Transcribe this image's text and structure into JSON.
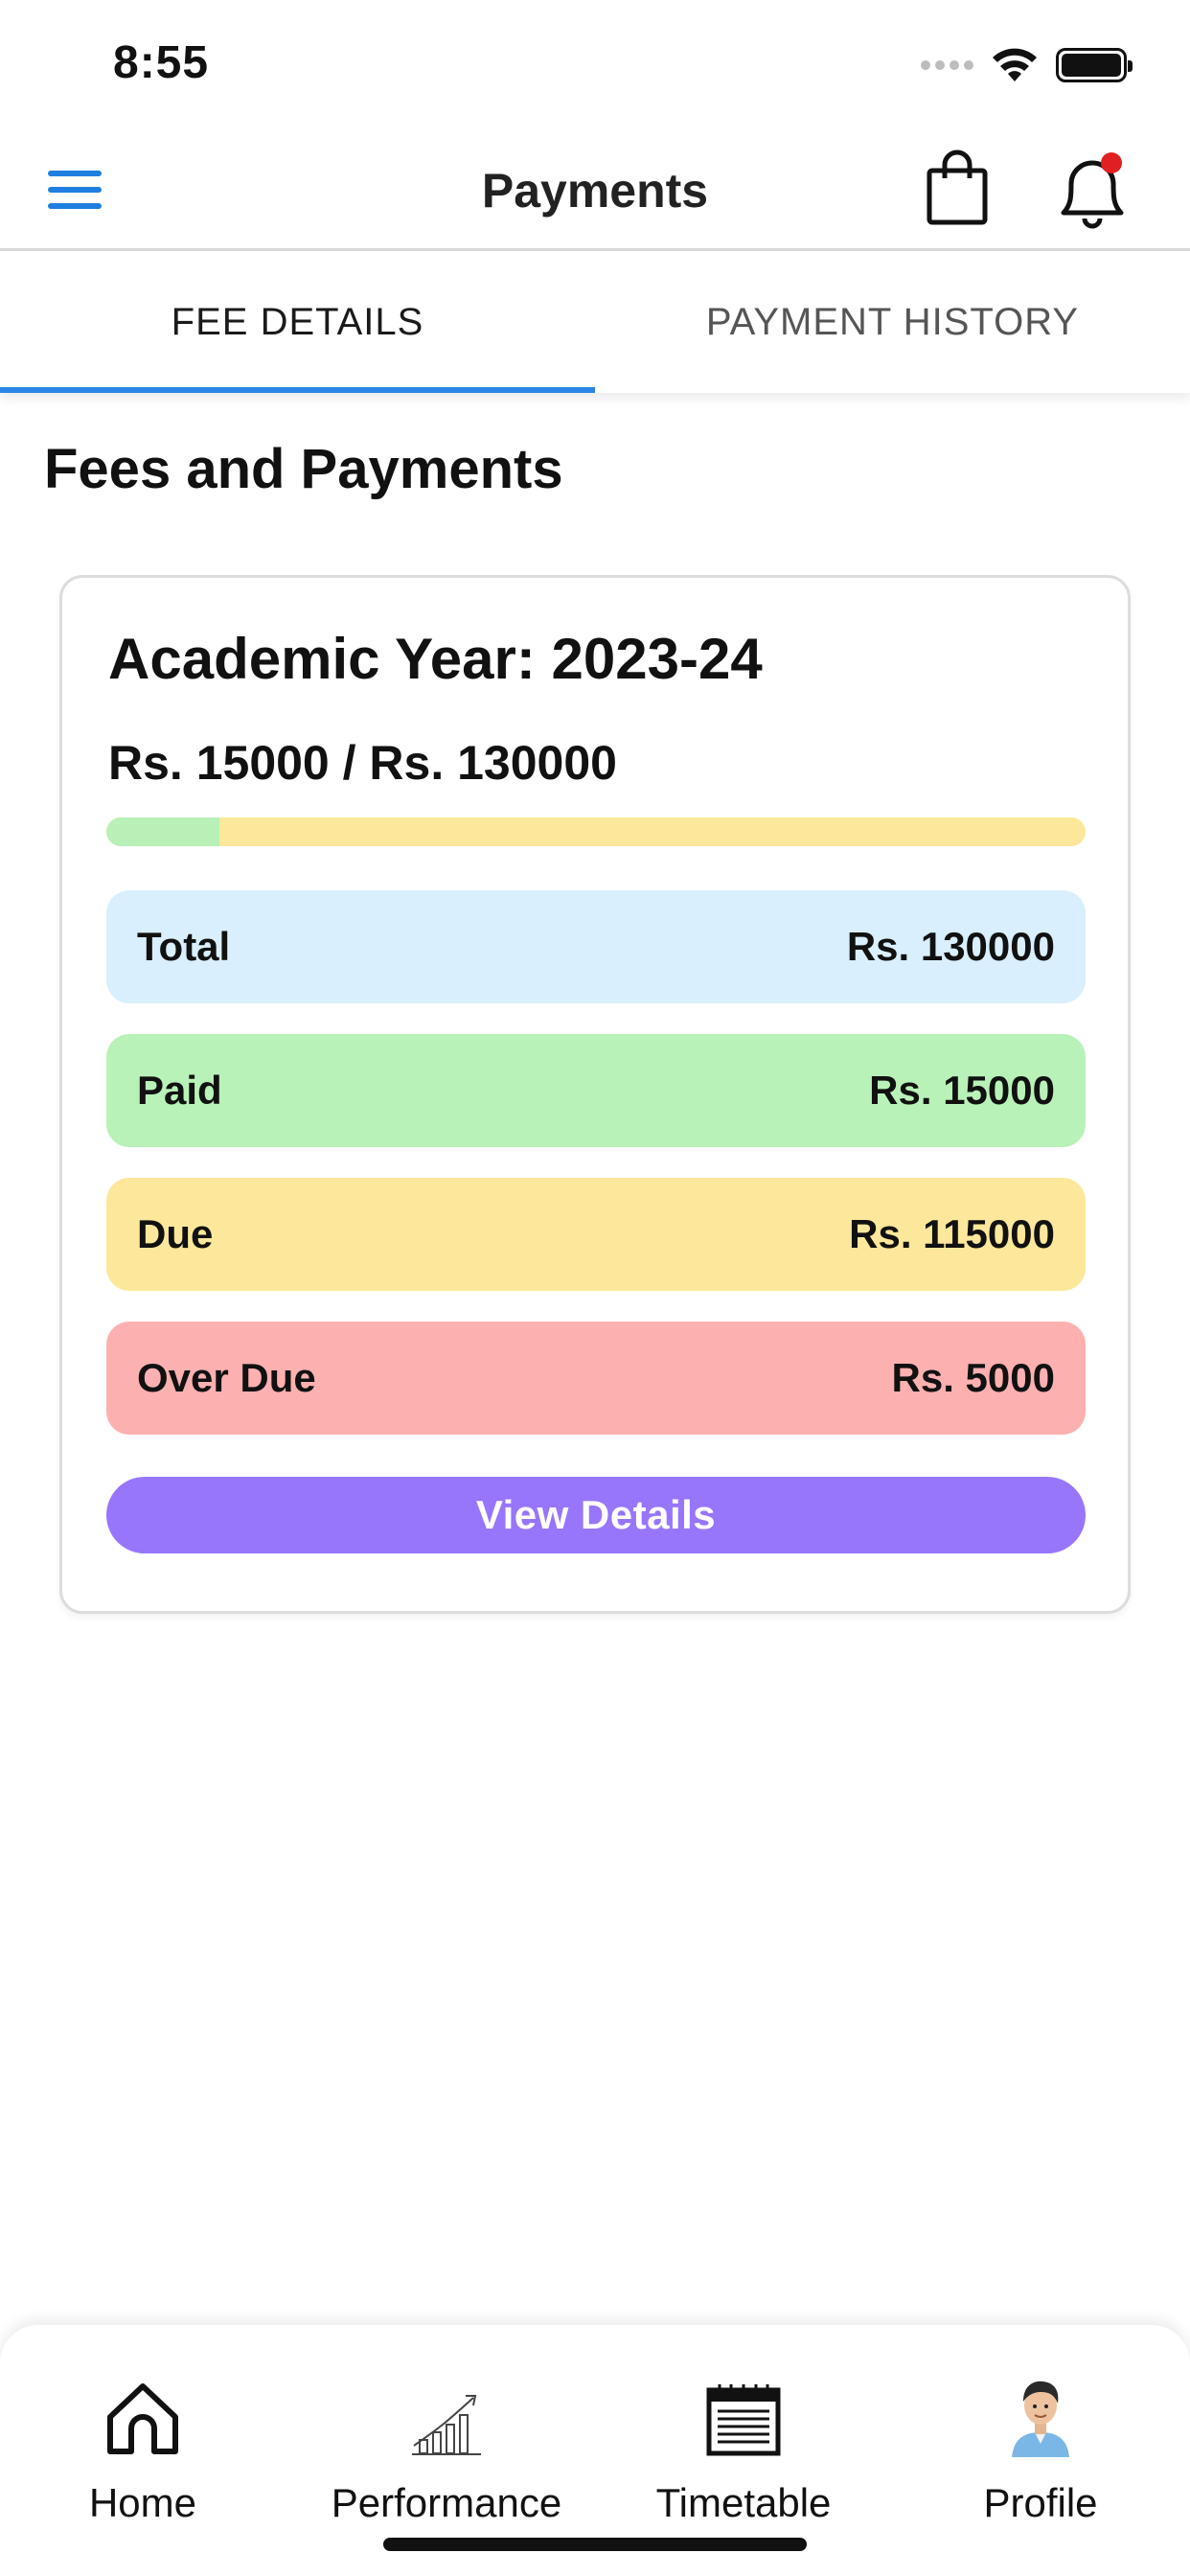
{
  "status_bar": {
    "time": "8:55",
    "icons": [
      "signal-icon",
      "wifi-icon",
      "battery-icon"
    ]
  },
  "header": {
    "title": "Payments",
    "icons": {
      "menu": "menu-icon",
      "cart": "shopping-bag-icon",
      "notifications": "bell-icon"
    },
    "notification_dot_color": "#e02020"
  },
  "tabs": [
    {
      "label": "FEE DETAILS",
      "active": true
    },
    {
      "label": "PAYMENT HISTORY",
      "active": false
    }
  ],
  "section": {
    "title": "Fees and Payments"
  },
  "fee_card": {
    "academic_year": "Academic Year: 2023-24",
    "amount_summary": "Rs. 15000 / Rs. 130000",
    "paid_fraction": 0.1154,
    "rows": [
      {
        "label": "Total",
        "value": "Rs. 130000",
        "color": "#d9effd"
      },
      {
        "label": "Paid",
        "value": "Rs. 15000",
        "color": "#b8f2b8"
      },
      {
        "label": "Due",
        "value": "Rs. 115000",
        "color": "#fde79a"
      },
      {
        "label": "Over Due",
        "value": "Rs. 5000",
        "color": "#fdb0b0"
      }
    ],
    "button_label": "View Details",
    "button_color": "#9776fc"
  },
  "bottom_nav": [
    {
      "label": "Home",
      "icon": "home-icon"
    },
    {
      "label": "Performance",
      "icon": "chart-growth-icon"
    },
    {
      "label": "Timetable",
      "icon": "calendar-icon"
    },
    {
      "label": "Profile",
      "icon": "avatar"
    }
  ],
  "colors": {
    "accent": "#1f7fe0",
    "tab_indicator": "#2a86e6"
  }
}
